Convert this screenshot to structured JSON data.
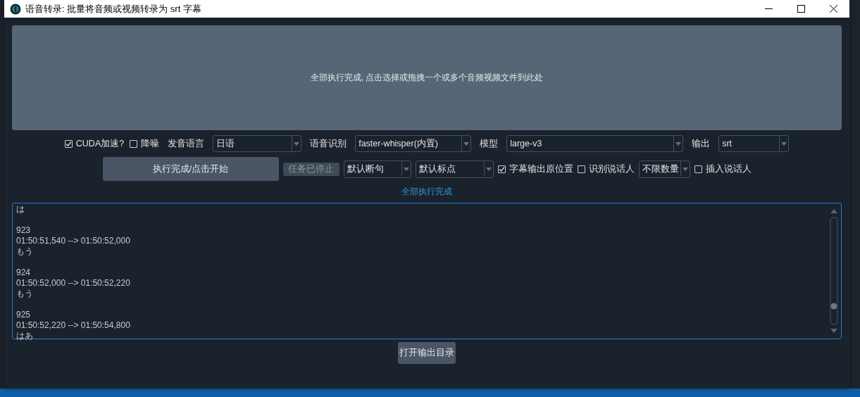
{
  "window": {
    "title": "语音转录: 批量将音频或视频转录为 srt 字幕"
  },
  "drop_zone": {
    "text": "全部执行完成, 点击选择或拖拽一个或多个音频视频文件到此处"
  },
  "options_row": [
    {
      "kind": "checkbox",
      "label": "CUDA加速?",
      "checked": true
    },
    {
      "kind": "checkbox",
      "label": "降噪",
      "checked": false
    },
    {
      "kind": "label",
      "text": "发音语言"
    },
    {
      "kind": "select",
      "value": "日语"
    },
    {
      "kind": "label",
      "text": "语音识别"
    },
    {
      "kind": "select",
      "value": "faster-whisper(内置)"
    },
    {
      "kind": "label",
      "text": "模型"
    },
    {
      "kind": "select",
      "value": "large-v3"
    },
    {
      "kind": "label",
      "text": "输出"
    },
    {
      "kind": "select",
      "value": "srt"
    }
  ],
  "actions_row": [
    {
      "kind": "button",
      "label": "执行完成/点击开始",
      "disabled": false
    },
    {
      "kind": "button",
      "label": "任务已停止",
      "disabled": true
    },
    {
      "kind": "select",
      "value": "默认断句"
    },
    {
      "kind": "select",
      "value": "默认标点"
    },
    {
      "kind": "checkbox",
      "label": "字幕输出原位置",
      "checked": true
    },
    {
      "kind": "checkbox",
      "label": "识别说话人",
      "checked": false
    },
    {
      "kind": "select",
      "value": "不限数量"
    },
    {
      "kind": "checkbox",
      "label": "插入说话人",
      "checked": false
    }
  ],
  "status": "全部执行完成",
  "log": {
    "entries": [
      {
        "lines": [
          "は"
        ]
      },
      {
        "lines": [
          "923",
          "01:50:51,540 --> 01:50:52,000",
          "もう"
        ]
      },
      {
        "lines": [
          "924",
          "01:50:52,000 --> 01:50:52,220",
          "もう"
        ]
      },
      {
        "lines": [
          "925",
          "01:50:52,220 --> 01:50:54,800",
          "はあ"
        ]
      }
    ]
  },
  "open_output_button": {
    "label": "打开输出目录"
  }
}
